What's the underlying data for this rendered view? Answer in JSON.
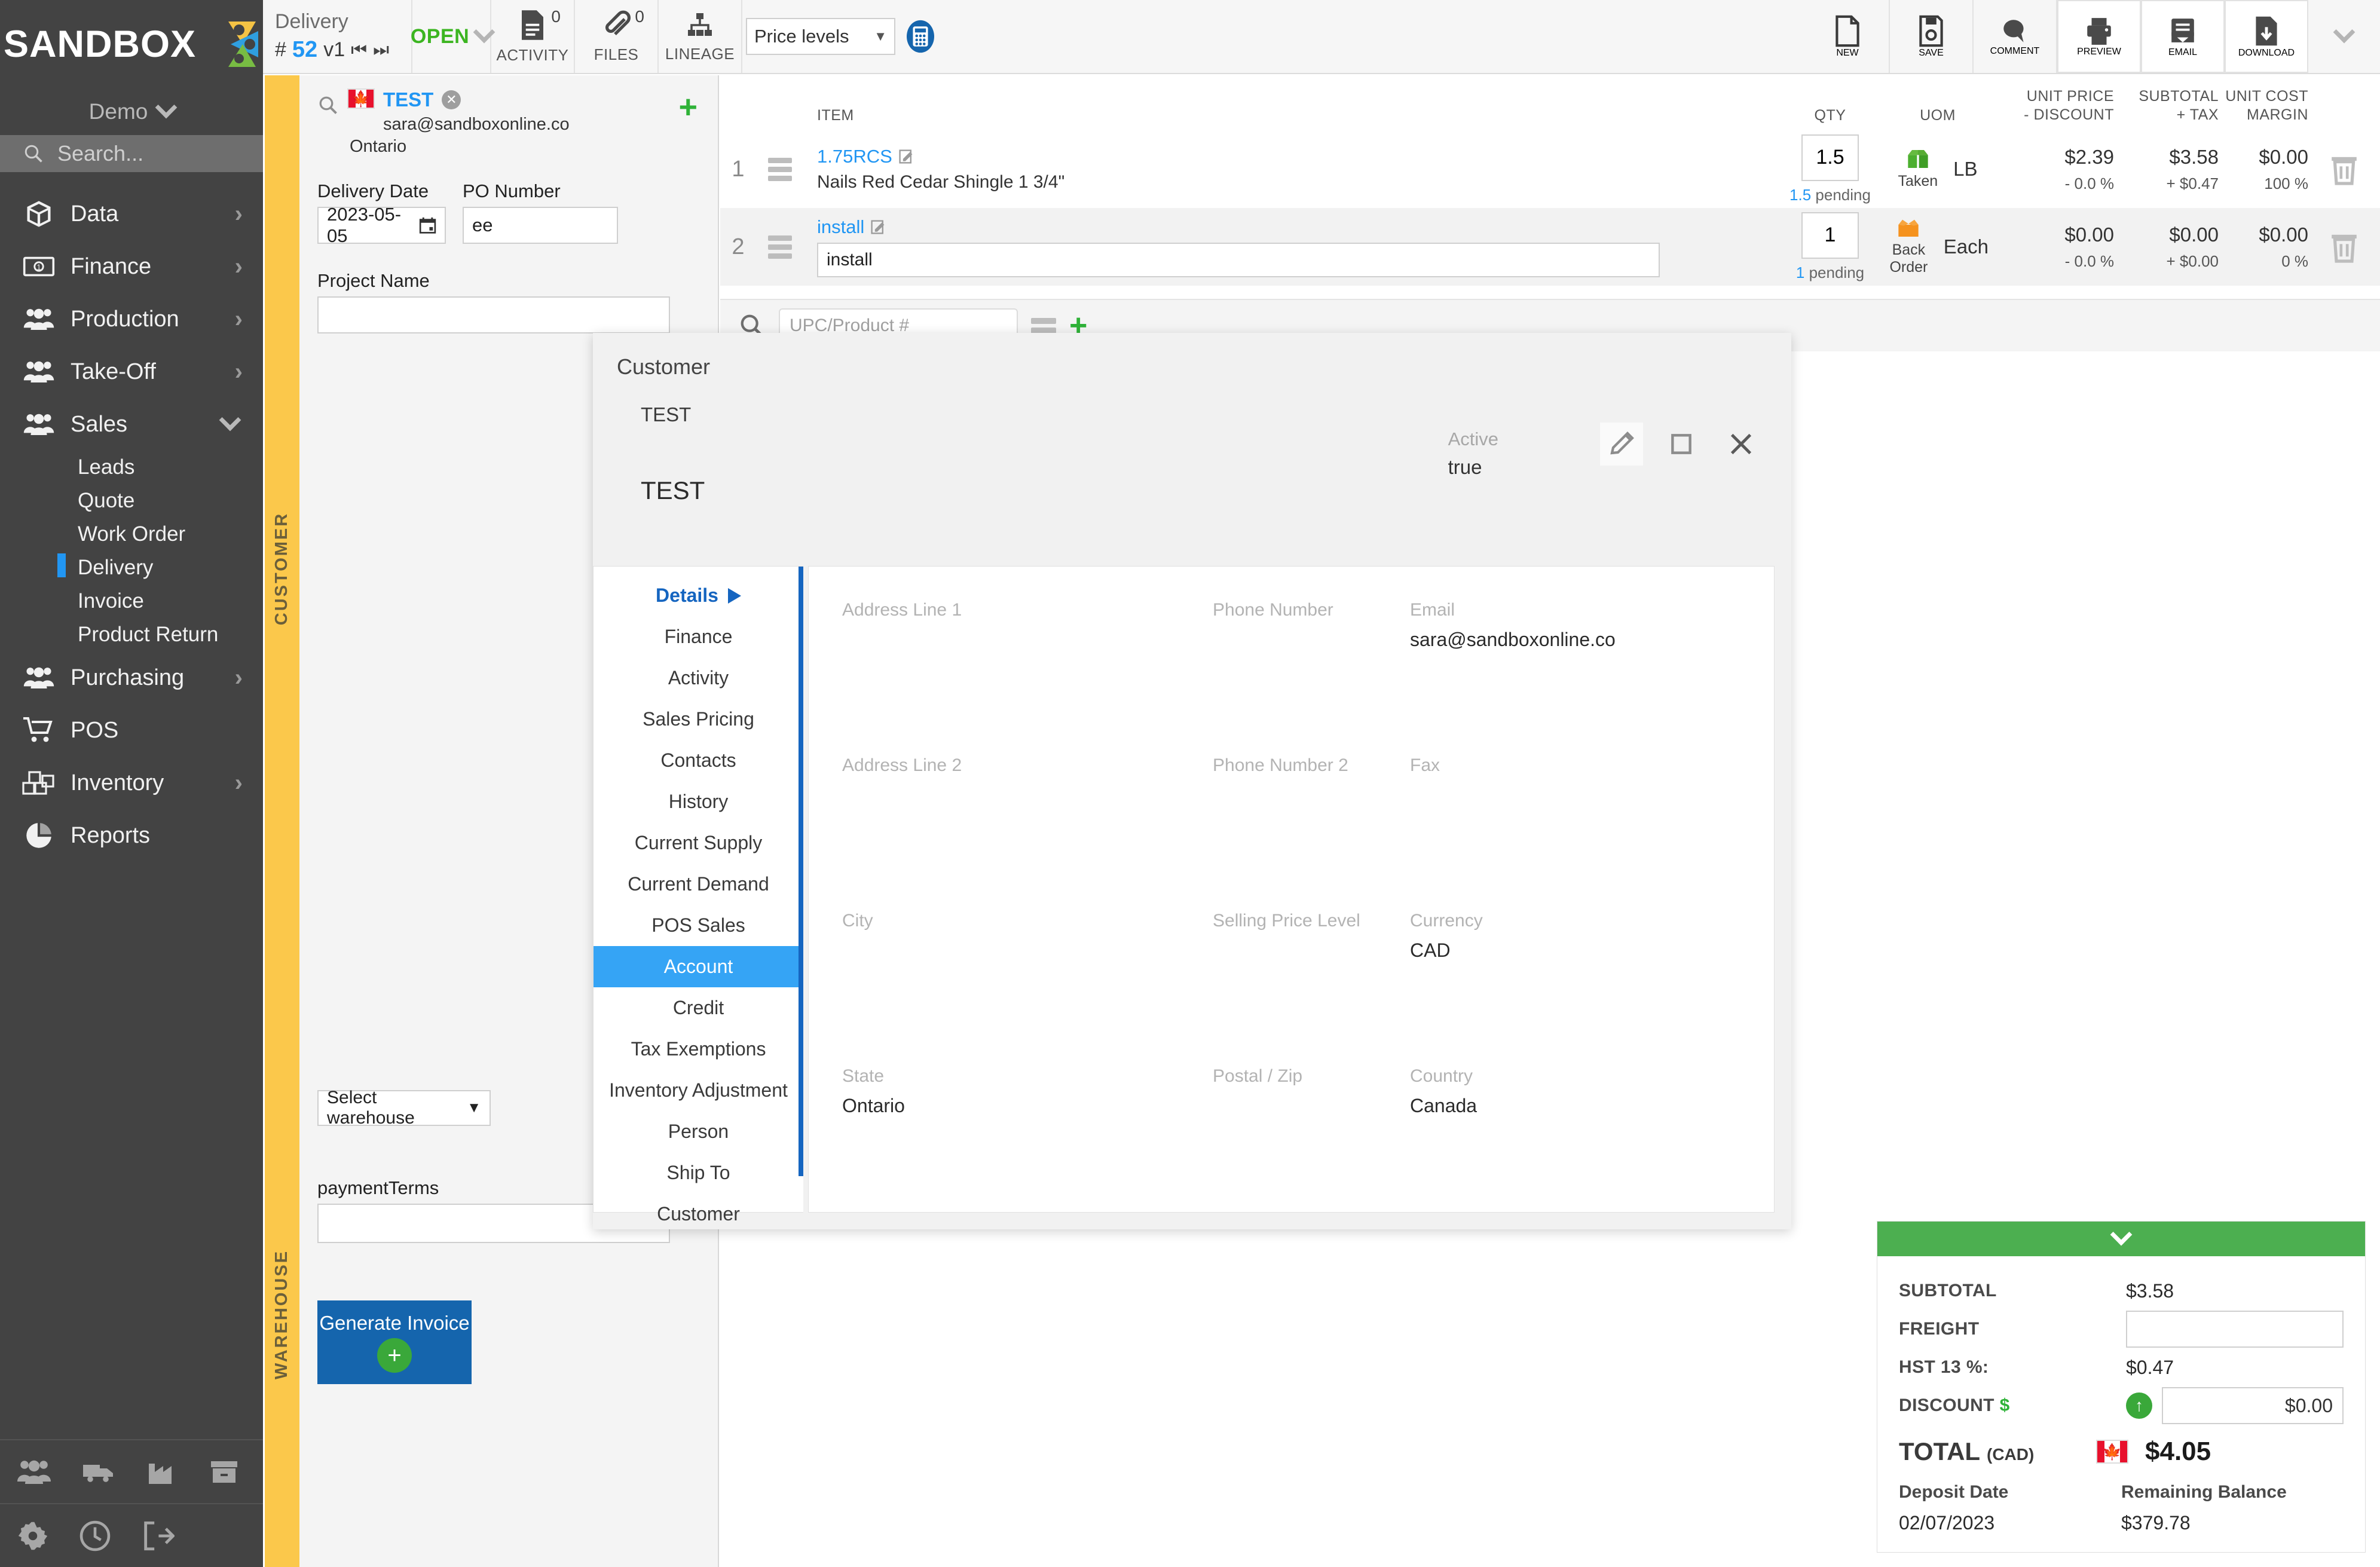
{
  "brand": {
    "name": "SANDBOX",
    "tenant": "Demo"
  },
  "search": {
    "placeholder": "Search..."
  },
  "sidebar": {
    "items": [
      {
        "label": "Data",
        "icon": "cube-icon",
        "expandable": true,
        "expanded": false
      },
      {
        "label": "Finance",
        "icon": "banknote-icon",
        "expandable": true,
        "expanded": false
      },
      {
        "label": "Production",
        "icon": "people-icon",
        "expandable": true,
        "expanded": false
      },
      {
        "label": "Take-Off",
        "icon": "people-icon",
        "expandable": true,
        "expanded": false
      },
      {
        "label": "Sales",
        "icon": "people-icon",
        "expandable": true,
        "expanded": true
      },
      {
        "label": "Purchasing",
        "icon": "people-icon",
        "expandable": true,
        "expanded": false
      },
      {
        "label": "POS",
        "icon": "cart-icon",
        "expandable": false,
        "expanded": false
      },
      {
        "label": "Inventory",
        "icon": "boxes-icon",
        "expandable": true,
        "expanded": false
      },
      {
        "label": "Reports",
        "icon": "pie-chart-icon",
        "expandable": false,
        "expanded": false
      }
    ],
    "sales_subitems": [
      {
        "label": "Leads",
        "active": false
      },
      {
        "label": "Quote",
        "active": false
      },
      {
        "label": "Work Order",
        "active": false
      },
      {
        "label": "Delivery",
        "active": true
      },
      {
        "label": "Invoice",
        "active": false
      },
      {
        "label": "Product Return",
        "active": false
      }
    ],
    "footer_icons_row1": [
      "people-icon",
      "truck-icon",
      "factory-icon",
      "archive-box-icon"
    ],
    "footer_icons_row2": [
      "gear-icon",
      "clock-icon",
      "logout-icon"
    ]
  },
  "topbar": {
    "doc_type": "Delivery",
    "doc_hash": "#",
    "doc_number": "52",
    "doc_version": "v1",
    "status": "OPEN",
    "activity": {
      "label": "ACTIVITY",
      "count": "0"
    },
    "files": {
      "label": "FILES",
      "count": "0"
    },
    "lineage": {
      "label": "LINEAGE"
    },
    "price_levels": {
      "selected": "Price levels"
    },
    "actions": [
      {
        "label": "NEW",
        "icon": "new-document-icon",
        "boxed": false
      },
      {
        "label": "SAVE",
        "icon": "save-disk-icon",
        "boxed": false
      },
      {
        "label": "COMMENT",
        "icon": "comment-bubble-icon",
        "boxed": false
      },
      {
        "label": "PREVIEW",
        "icon": "printer-icon",
        "boxed": true
      },
      {
        "label": "EMAIL",
        "icon": "email-envelope-icon",
        "boxed": true
      },
      {
        "label": "DOWNLOAD",
        "icon": "download-document-icon",
        "boxed": true
      }
    ]
  },
  "left_panel": {
    "customer_strip_label": "CUSTOMER",
    "warehouse_strip_label": "WAREHOUSE",
    "customer": {
      "name": "TEST",
      "email": "sara@sandboxonline.co",
      "province": "Ontario",
      "country_flag": "canada-flag-icon"
    },
    "delivery_date": {
      "label": "Delivery Date",
      "value": "2023-05-05"
    },
    "po_number": {
      "label": "PO Number",
      "value": "ee"
    },
    "project_name": {
      "label": "Project Name",
      "value": ""
    },
    "warehouse_select": {
      "value": "Select warehouse"
    },
    "payment_terms": {
      "label": "paymentTerms",
      "value": ""
    },
    "generate_invoice": {
      "label": "Generate Invoice"
    }
  },
  "items_table": {
    "headers": {
      "item": "ITEM",
      "qty": "QTY",
      "uom": "UOM",
      "unit_price": "UNIT PRICE",
      "discount": "- DISCOUNT",
      "subtotal": "SUBTOTAL",
      "tax": "+ TAX",
      "unit_cost": "UNIT COST",
      "margin": "MARGIN"
    },
    "rows": [
      {
        "no": "1",
        "code": "1.75RCS",
        "description": "Nails Red Cedar Shingle 1 3/4\"",
        "description_is_input": false,
        "qty": "1.5",
        "pending_qty": "1.5",
        "pending_label": "pending",
        "status": "Taken",
        "status_icon": "open-box-green-icon",
        "uom": "LB",
        "unit_price": "$2.39",
        "discount": "- 0.0 %",
        "subtotal": "$3.58",
        "tax": "+ $0.47",
        "unit_cost": "$0.00",
        "margin": "100 %"
      },
      {
        "no": "2",
        "code": "install",
        "description": "install",
        "description_is_input": true,
        "qty": "1",
        "pending_qty": "1",
        "pending_label": "pending",
        "status": "Back Order",
        "status_icon": "back-order-box-orange-icon",
        "uom": "Each",
        "unit_price": "$0.00",
        "discount": "- 0.0 %",
        "subtotal": "$0.00",
        "tax": "+ $0.00",
        "unit_cost": "$0.00",
        "margin": "0 %"
      }
    ],
    "upc_search": {
      "placeholder": "UPC/Product #"
    }
  },
  "modal": {
    "title": "Customer",
    "value_small": "TEST",
    "value_large": "TEST",
    "active": {
      "label": "Active",
      "value": "true"
    },
    "icons": [
      {
        "name": "edit-pencil-icon",
        "selected": true
      },
      {
        "name": "maximize-window-icon",
        "selected": false
      },
      {
        "name": "close-x-icon",
        "selected": false
      }
    ],
    "menu": [
      {
        "label": "Details",
        "first": true,
        "selected": false
      },
      {
        "label": "Finance",
        "first": false,
        "selected": false
      },
      {
        "label": "Activity",
        "first": false,
        "selected": false
      },
      {
        "label": "Sales Pricing",
        "first": false,
        "selected": false
      },
      {
        "label": "Contacts",
        "first": false,
        "selected": false
      },
      {
        "label": "History",
        "first": false,
        "selected": false
      },
      {
        "label": "Current Supply",
        "first": false,
        "selected": false
      },
      {
        "label": "Current Demand",
        "first": false,
        "selected": false
      },
      {
        "label": "POS Sales",
        "first": false,
        "selected": false
      },
      {
        "label": "Account",
        "first": false,
        "selected": true
      },
      {
        "label": "Credit",
        "first": false,
        "selected": false
      },
      {
        "label": "Tax Exemptions",
        "first": false,
        "selected": false
      },
      {
        "label": "Inventory Adjustment",
        "first": false,
        "selected": false
      },
      {
        "label": "Person",
        "first": false,
        "selected": false
      },
      {
        "label": "Ship To",
        "first": false,
        "selected": false
      },
      {
        "label": "Customer",
        "first": false,
        "selected": false
      }
    ],
    "fields": {
      "address_line_1": {
        "label": "Address Line 1",
        "value": ""
      },
      "address_line_2": {
        "label": "Address Line 2",
        "value": ""
      },
      "city": {
        "label": "City",
        "value": ""
      },
      "state": {
        "label": "State",
        "value": "Ontario"
      },
      "phone_number": {
        "label": "Phone Number",
        "value": ""
      },
      "phone_number_2": {
        "label": "Phone Number 2",
        "value": ""
      },
      "selling_price_level": {
        "label": "Selling Price Level",
        "value": ""
      },
      "postal_zip": {
        "label": "Postal / Zip",
        "value": ""
      },
      "email": {
        "label": "Email",
        "value": "sara@sandboxonline.co"
      },
      "fax": {
        "label": "Fax",
        "value": ""
      },
      "currency": {
        "label": "Currency",
        "value": "CAD"
      },
      "country": {
        "label": "Country",
        "value": "Canada"
      }
    }
  },
  "totals": {
    "subtotal": {
      "label": "SUBTOTAL",
      "value": "$3.58"
    },
    "freight": {
      "label": "FREIGHT",
      "value": ""
    },
    "hst": {
      "label": "HST 13 %:",
      "value": "$0.47"
    },
    "discount": {
      "label": "DISCOUNT",
      "symbol": "$",
      "value": "$0.00"
    },
    "total": {
      "label": "TOTAL",
      "currency": "(CAD)",
      "value": "$4.05"
    },
    "deposit_date": {
      "label": "Deposit Date",
      "value": "02/07/2023"
    },
    "remaining_balance": {
      "label": "Remaining Balance",
      "value": "$379.78"
    }
  },
  "colors": {
    "accent_blue": "#2196f3",
    "sidebar_bg": "#434343",
    "strip_yellow": "#fbc84b",
    "green": "#4caf50",
    "orange": "#f5921e",
    "button_blue": "#1565ad"
  }
}
